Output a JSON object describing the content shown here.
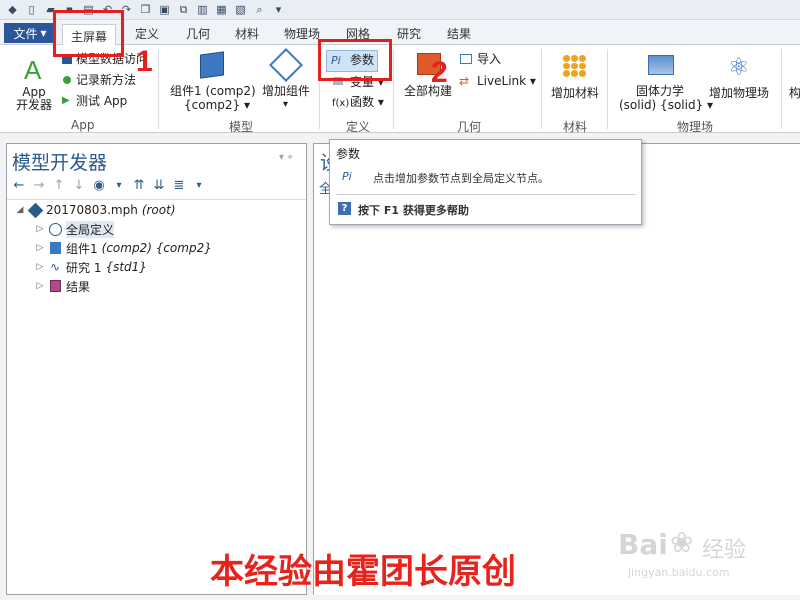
{
  "toolbar": {
    "file_label": "文件",
    "file_arrow": "▾"
  },
  "tabs": [
    "主屏幕",
    "定义",
    "几何",
    "材料",
    "物理场",
    "网格",
    "研究",
    "结果"
  ],
  "ribbon": {
    "app": {
      "app_btn": "App\n开发器",
      "model_data_access": "模型数据访问",
      "record_method": "记录新方法",
      "test_app": "测试 App",
      "group": "App"
    },
    "model": {
      "component": "组件1 (comp2)",
      "component_sub": "{comp2} ▾",
      "add_component": "增加组件",
      "group": "模型"
    },
    "definitions": {
      "parameters": "参数",
      "variables": "变量 ▾",
      "functions_prefix": "f(x)",
      "functions": "函数 ▾",
      "group": "定义"
    },
    "geometry": {
      "build_all": "全部构建",
      "import": "导入",
      "livelink": "LiveLink ▾",
      "group": "几何"
    },
    "materials": {
      "add_material": "增加材料",
      "group": "材料"
    },
    "physics": {
      "solid": "固体力学",
      "solid_sub": "(solid) {solid} ▾",
      "add_physics": "增加物理场",
      "group": "物理场"
    },
    "more": "构"
  },
  "annotations": {
    "num1": "1",
    "num2": "2"
  },
  "model_builder": {
    "title": "模型开发器",
    "pin": "▾  ⌖",
    "tree": [
      {
        "label": "20170803.mph",
        "extra": "(root)"
      },
      {
        "label": "全局定义",
        "extra": ""
      },
      {
        "label": "组件1",
        "extra": "(comp2) {comp2}"
      },
      {
        "label": "研究 1",
        "extra": "{std1}"
      },
      {
        "label": "结果",
        "extra": ""
      }
    ]
  },
  "right_panel": {
    "title": "设",
    "sub": "全"
  },
  "tooltip": {
    "title": "参数",
    "icon": "Pi",
    "desc": "点击增加参数节点到全局定义节点。",
    "help_icon": "?",
    "help": "按下 F1 获得更多帮助"
  },
  "watermark": "本经验由霍团长原创",
  "baidu": {
    "brand": "Bai",
    "brand2": "经验",
    "url": "jingyan.baidu.com"
  },
  "colors": {
    "accent": "#2b579a",
    "annotation": "#e41f1f",
    "watermark": "#e8231b"
  }
}
